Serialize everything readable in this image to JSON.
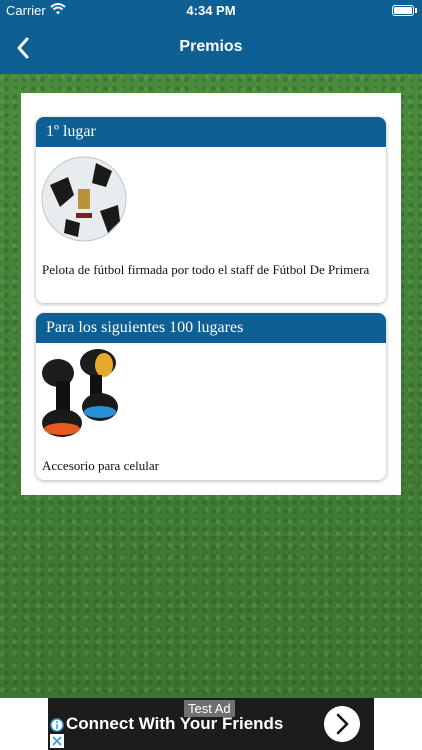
{
  "status_bar": {
    "carrier": "Carrier",
    "time": "4:34 PM"
  },
  "nav": {
    "title": "Premios"
  },
  "prizes": [
    {
      "header": "1º lugar",
      "description": "Pelota de fútbol firmada por todo el staff de Fútbol De Primera",
      "image": "soccer-ball"
    },
    {
      "header": "Para los siguientes 100 lugares",
      "description": "Accesorio para celular",
      "image": "phone-holder-accessory"
    }
  ],
  "ad": {
    "tag": "Test Ad",
    "headline": "Connect With Your Friends"
  },
  "colors": {
    "brand": "#0d5f94",
    "grass": "#3f7d35"
  },
  "icons": [
    "back-chevron-icon",
    "wifi-icon",
    "battery-icon",
    "ad-info-icon",
    "ad-close-icon",
    "ad-arrow-icon"
  ]
}
